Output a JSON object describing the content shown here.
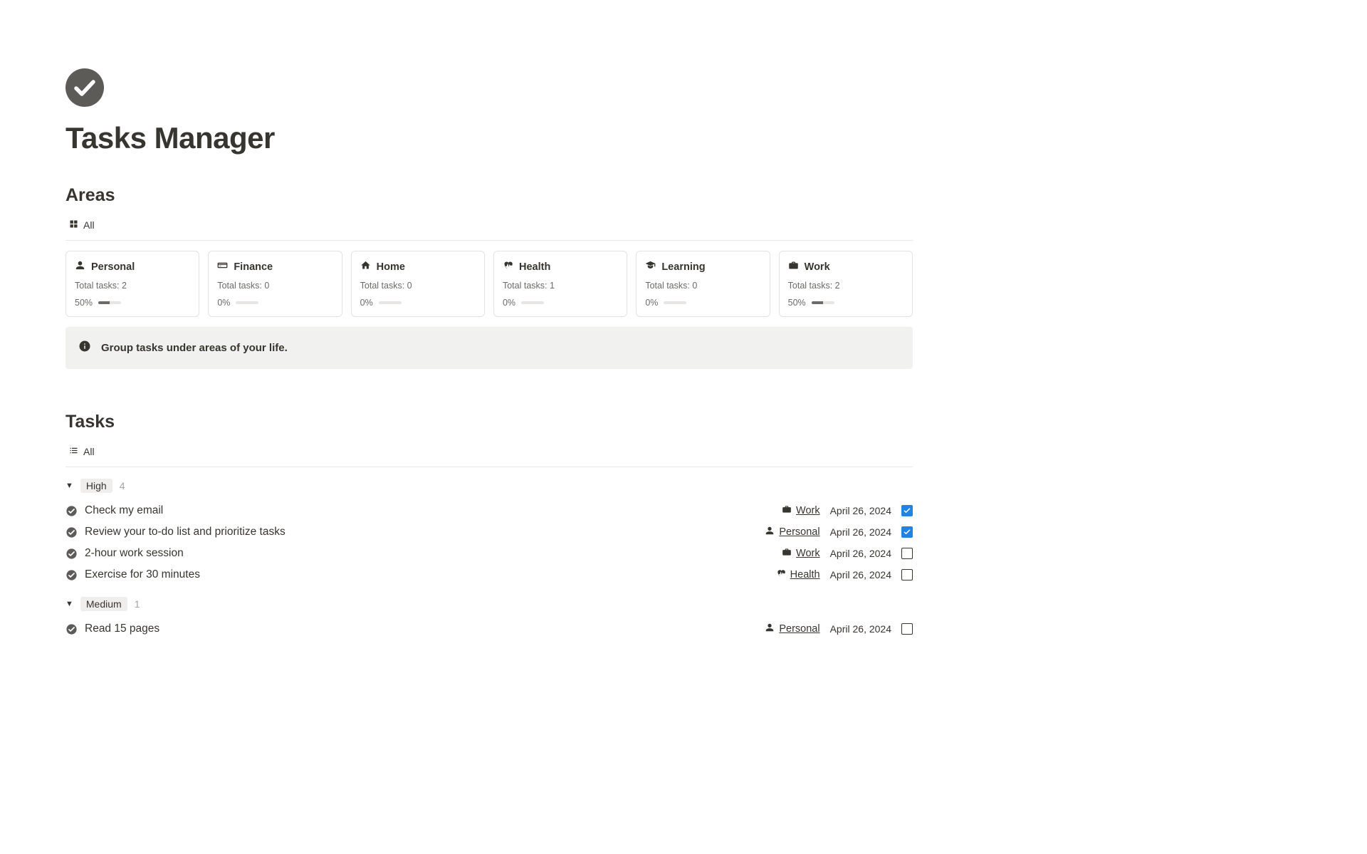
{
  "page": {
    "title": "Tasks Manager"
  },
  "areasSection": {
    "heading": "Areas",
    "viewLabel": "All"
  },
  "areas": [
    {
      "name": "Personal",
      "icon": "person",
      "total_label": "Total tasks: 2",
      "percent_label": "50%",
      "percent": 50
    },
    {
      "name": "Finance",
      "icon": "creditcard",
      "total_label": "Total tasks: 0",
      "percent_label": "0%",
      "percent": 0
    },
    {
      "name": "Home",
      "icon": "house",
      "total_label": "Total tasks: 0",
      "percent_label": "0%",
      "percent": 0
    },
    {
      "name": "Health",
      "icon": "heartbeat",
      "total_label": "Total tasks: 1",
      "percent_label": "0%",
      "percent": 0
    },
    {
      "name": "Learning",
      "icon": "gradcap",
      "total_label": "Total tasks: 0",
      "percent_label": "0%",
      "percent": 0
    },
    {
      "name": "Work",
      "icon": "briefcase",
      "total_label": "Total tasks: 2",
      "percent_label": "50%",
      "percent": 50
    }
  ],
  "callout": {
    "text": "Group tasks under areas of your life."
  },
  "tasksSection": {
    "heading": "Tasks",
    "viewLabel": "All"
  },
  "groups": [
    {
      "label": "High",
      "count": "4",
      "tasks": [
        {
          "title": "Check my email",
          "area": "Work",
          "areaIcon": "briefcase",
          "date": "April 26, 2024",
          "done": true
        },
        {
          "title": "Review your to-do list and prioritize tasks",
          "area": "Personal",
          "areaIcon": "person",
          "date": "April 26, 2024",
          "done": true
        },
        {
          "title": "2-hour work session",
          "area": "Work",
          "areaIcon": "briefcase",
          "date": "April 26, 2024",
          "done": false
        },
        {
          "title": "Exercise for 30 minutes",
          "area": "Health",
          "areaIcon": "heartbeat",
          "date": "April 26, 2024",
          "done": false
        }
      ]
    },
    {
      "label": "Medium",
      "count": "1",
      "tasks": [
        {
          "title": "Read 15 pages",
          "area": "Personal",
          "areaIcon": "person",
          "date": "April 26, 2024",
          "done": false
        }
      ]
    }
  ]
}
